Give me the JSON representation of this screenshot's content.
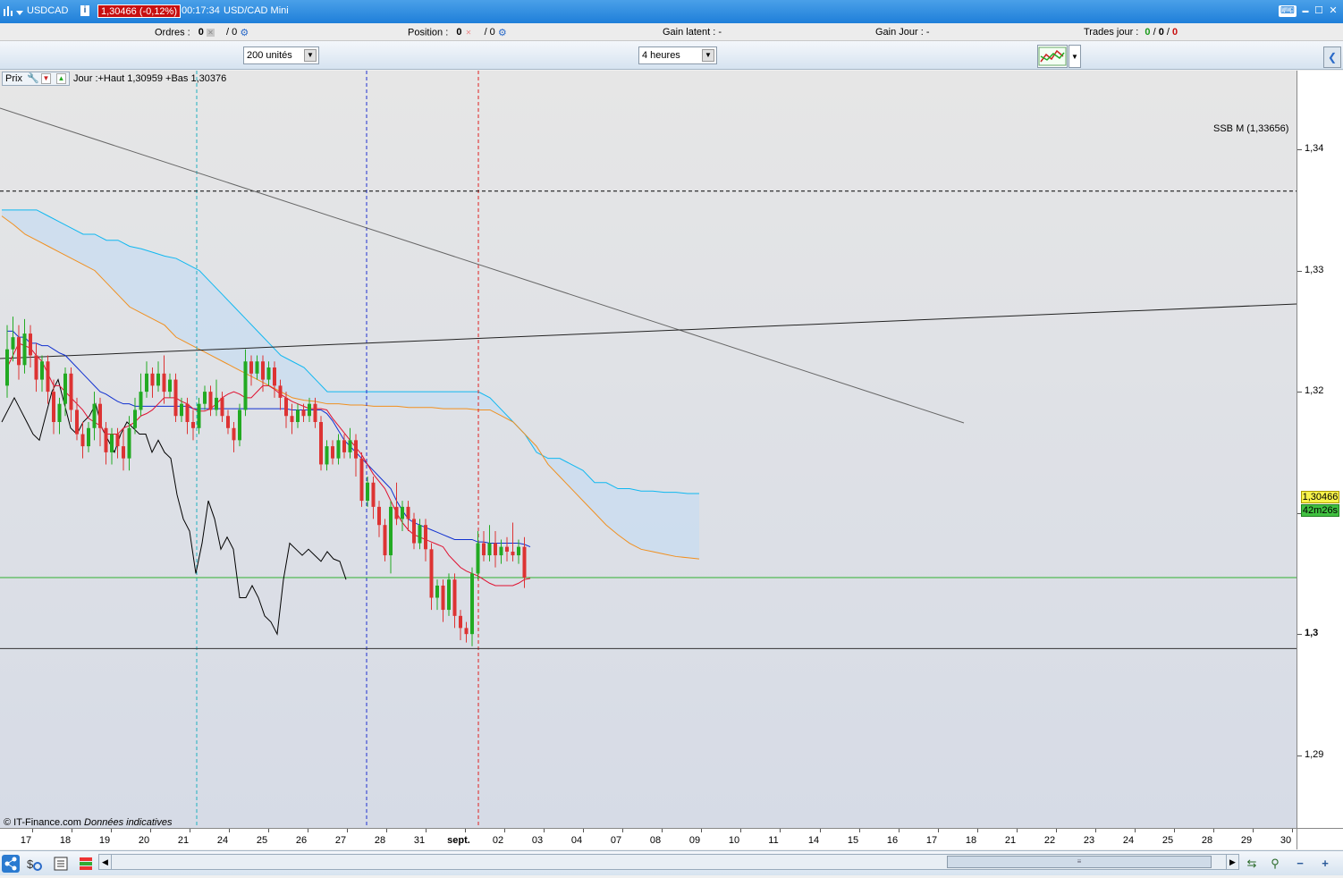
{
  "titlebar": {
    "symbol": "USDCAD",
    "info": "i",
    "price_badge": "1,30466 (-0,12%)",
    "time": "00:17:34",
    "name": "USD/CAD Mini",
    "kbd_icon": "⌨",
    "min": "▬",
    "max": "☐",
    "close": "✕"
  },
  "toolbar": {
    "ordres_label": "Ordres :",
    "ordres_value": "0",
    "ordres_slash": "/ 0",
    "position_label": "Position :",
    "position_value": "0",
    "position_slash": "/ 0",
    "gain_latent": "Gain latent :  -",
    "gain_jour": "Gain Jour :  -",
    "trades_label": "Trades jour :",
    "trades_a": "0",
    "trades_b": "0",
    "trades_c": "0",
    "quantity_select": "200 unités",
    "period_select": "4 heures",
    "x_glyph": "✕",
    "gear_glyph": "⚙"
  },
  "chart": {
    "prix_label": "Prix",
    "ohlc_text": "Jour :+Haut 1,30959 +Bas 1,30376",
    "ssb_label": "SSB M (1,33656)",
    "copyright": "© IT-Finance.com",
    "disclaimer": "Données indicatives",
    "price_tag": "1,30466",
    "timer_tag": "42m26s"
  },
  "colors": {
    "bull": "#22aa22",
    "bear": "#dd3333",
    "tenkan": "#e01030",
    "kijun": "#1030d0",
    "ssa": "#f09020",
    "ssb": "#10b8f0",
    "chikou": "#000000",
    "cloud": "#c8dcf0"
  },
  "chart_data": {
    "type": "candlestick",
    "ylim": [
      1.284,
      1.3465
    ],
    "y_ticks": [
      "1,34",
      "1,33",
      "1,32",
      "1,31",
      "1,3",
      "1,29"
    ],
    "x_ticks": [
      "17",
      "18",
      "19",
      "20",
      "21",
      "24",
      "25",
      "26",
      "27",
      "28",
      "31",
      "sept.",
      "02",
      "03",
      "04",
      "07",
      "08",
      "09",
      "10",
      "11",
      "14",
      "15",
      "16",
      "17",
      "18",
      "21",
      "22",
      "23",
      "24",
      "25",
      "28",
      "29",
      "30"
    ],
    "current_price": 1.30466,
    "ssb_level": 1.33656,
    "support_level": 1.2988,
    "candles": [
      {
        "o": 1.3205,
        "c": 1.3235,
        "h": 1.3255,
        "l": 1.3195
      },
      {
        "o": 1.3235,
        "c": 1.3245,
        "h": 1.3262,
        "l": 1.3225
      },
      {
        "o": 1.3245,
        "c": 1.3222,
        "h": 1.3255,
        "l": 1.321
      },
      {
        "o": 1.3222,
        "c": 1.3248,
        "h": 1.326,
        "l": 1.3215
      },
      {
        "o": 1.3248,
        "c": 1.323,
        "h": 1.3255,
        "l": 1.322
      },
      {
        "o": 1.323,
        "c": 1.321,
        "h": 1.324,
        "l": 1.32
      },
      {
        "o": 1.321,
        "c": 1.3225,
        "h": 1.323,
        "l": 1.32
      },
      {
        "o": 1.3225,
        "c": 1.32,
        "h": 1.323,
        "l": 1.319
      },
      {
        "o": 1.32,
        "c": 1.3175,
        "h": 1.321,
        "l": 1.3165
      },
      {
        "o": 1.3175,
        "c": 1.319,
        "h": 1.3195,
        "l": 1.3165
      },
      {
        "o": 1.319,
        "c": 1.3215,
        "h": 1.322,
        "l": 1.318
      },
      {
        "o": 1.3215,
        "c": 1.3185,
        "h": 1.322,
        "l": 1.3175
      },
      {
        "o": 1.3185,
        "c": 1.3165,
        "h": 1.3195,
        "l": 1.316
      },
      {
        "o": 1.3165,
        "c": 1.3155,
        "h": 1.3175,
        "l": 1.3145
      },
      {
        "o": 1.3155,
        "c": 1.317,
        "h": 1.3175,
        "l": 1.315
      },
      {
        "o": 1.317,
        "c": 1.319,
        "h": 1.32,
        "l": 1.316
      },
      {
        "o": 1.319,
        "c": 1.317,
        "h": 1.3195,
        "l": 1.3155
      },
      {
        "o": 1.317,
        "c": 1.315,
        "h": 1.3175,
        "l": 1.314
      },
      {
        "o": 1.315,
        "c": 1.3165,
        "h": 1.317,
        "l": 1.314
      },
      {
        "o": 1.3165,
        "c": 1.3155,
        "h": 1.317,
        "l": 1.3145
      },
      {
        "o": 1.3155,
        "c": 1.3145,
        "h": 1.317,
        "l": 1.3135
      },
      {
        "o": 1.3145,
        "c": 1.317,
        "h": 1.318,
        "l": 1.3135
      },
      {
        "o": 1.317,
        "c": 1.3185,
        "h": 1.3195,
        "l": 1.3165
      },
      {
        "o": 1.3185,
        "c": 1.32,
        "h": 1.3215,
        "l": 1.318
      },
      {
        "o": 1.32,
        "c": 1.3215,
        "h": 1.3225,
        "l": 1.3195
      },
      {
        "o": 1.3215,
        "c": 1.3205,
        "h": 1.322,
        "l": 1.3195
      },
      {
        "o": 1.3205,
        "c": 1.3215,
        "h": 1.3225,
        "l": 1.32
      },
      {
        "o": 1.3215,
        "c": 1.32,
        "h": 1.323,
        "l": 1.319
      },
      {
        "o": 1.32,
        "c": 1.321,
        "h": 1.3215,
        "l": 1.3195
      },
      {
        "o": 1.321,
        "c": 1.318,
        "h": 1.3215,
        "l": 1.3175
      },
      {
        "o": 1.318,
        "c": 1.319,
        "h": 1.3195,
        "l": 1.3175
      },
      {
        "o": 1.319,
        "c": 1.3175,
        "h": 1.3195,
        "l": 1.3165
      },
      {
        "o": 1.3175,
        "c": 1.317,
        "h": 1.3185,
        "l": 1.316
      },
      {
        "o": 1.317,
        "c": 1.319,
        "h": 1.3195,
        "l": 1.3165
      },
      {
        "o": 1.319,
        "c": 1.32,
        "h": 1.3205,
        "l": 1.3185
      },
      {
        "o": 1.32,
        "c": 1.3185,
        "h": 1.3205,
        "l": 1.318
      },
      {
        "o": 1.3185,
        "c": 1.3195,
        "h": 1.321,
        "l": 1.318
      },
      {
        "o": 1.3195,
        "c": 1.318,
        "h": 1.32,
        "l": 1.3175
      },
      {
        "o": 1.318,
        "c": 1.317,
        "h": 1.3185,
        "l": 1.3165
      },
      {
        "o": 1.317,
        "c": 1.316,
        "h": 1.3175,
        "l": 1.315
      },
      {
        "o": 1.316,
        "c": 1.3185,
        "h": 1.319,
        "l": 1.3155
      },
      {
        "o": 1.3185,
        "c": 1.3225,
        "h": 1.3235,
        "l": 1.318
      },
      {
        "o": 1.3225,
        "c": 1.3215,
        "h": 1.323,
        "l": 1.3205
      },
      {
        "o": 1.3215,
        "c": 1.3225,
        "h": 1.323,
        "l": 1.321
      },
      {
        "o": 1.3225,
        "c": 1.321,
        "h": 1.323,
        "l": 1.32
      },
      {
        "o": 1.321,
        "c": 1.322,
        "h": 1.3225,
        "l": 1.3205
      },
      {
        "o": 1.322,
        "c": 1.3205,
        "h": 1.3225,
        "l": 1.3195
      },
      {
        "o": 1.3205,
        "c": 1.3195,
        "h": 1.321,
        "l": 1.3185
      },
      {
        "o": 1.3195,
        "c": 1.318,
        "h": 1.32,
        "l": 1.317
      },
      {
        "o": 1.318,
        "c": 1.3175,
        "h": 1.319,
        "l": 1.3165
      },
      {
        "o": 1.3175,
        "c": 1.3185,
        "h": 1.319,
        "l": 1.317
      },
      {
        "o": 1.3185,
        "c": 1.318,
        "h": 1.319,
        "l": 1.3175
      },
      {
        "o": 1.318,
        "c": 1.319,
        "h": 1.3195,
        "l": 1.3175
      },
      {
        "o": 1.319,
        "c": 1.3175,
        "h": 1.3195,
        "l": 1.317
      },
      {
        "o": 1.3175,
        "c": 1.314,
        "h": 1.318,
        "l": 1.3135
      },
      {
        "o": 1.314,
        "c": 1.3155,
        "h": 1.316,
        "l": 1.3135
      },
      {
        "o": 1.3155,
        "c": 1.3145,
        "h": 1.316,
        "l": 1.314
      },
      {
        "o": 1.3145,
        "c": 1.316,
        "h": 1.3165,
        "l": 1.314
      },
      {
        "o": 1.316,
        "c": 1.315,
        "h": 1.3165,
        "l": 1.3145
      },
      {
        "o": 1.315,
        "c": 1.316,
        "h": 1.317,
        "l": 1.3145
      },
      {
        "o": 1.316,
        "c": 1.3145,
        "h": 1.3165,
        "l": 1.313
      },
      {
        "o": 1.3145,
        "c": 1.311,
        "h": 1.315,
        "l": 1.3105
      },
      {
        "o": 1.311,
        "c": 1.3125,
        "h": 1.313,
        "l": 1.3105
      },
      {
        "o": 1.3125,
        "c": 1.3105,
        "h": 1.313,
        "l": 1.3095
      },
      {
        "o": 1.3105,
        "c": 1.309,
        "h": 1.311,
        "l": 1.308
      },
      {
        "o": 1.309,
        "c": 1.3065,
        "h": 1.3095,
        "l": 1.306
      },
      {
        "o": 1.3065,
        "c": 1.3105,
        "h": 1.311,
        "l": 1.305
      },
      {
        "o": 1.3105,
        "c": 1.3095,
        "h": 1.3125,
        "l": 1.309
      },
      {
        "o": 1.3095,
        "c": 1.3105,
        "h": 1.311,
        "l": 1.3085
      },
      {
        "o": 1.3105,
        "c": 1.3095,
        "h": 1.311,
        "l": 1.3085
      },
      {
        "o": 1.3095,
        "c": 1.3075,
        "h": 1.31,
        "l": 1.307
      },
      {
        "o": 1.3075,
        "c": 1.309,
        "h": 1.3095,
        "l": 1.307
      },
      {
        "o": 1.309,
        "c": 1.307,
        "h": 1.3095,
        "l": 1.306
      },
      {
        "o": 1.307,
        "c": 1.303,
        "h": 1.3075,
        "l": 1.302
      },
      {
        "o": 1.303,
        "c": 1.304,
        "h": 1.3045,
        "l": 1.302
      },
      {
        "o": 1.304,
        "c": 1.302,
        "h": 1.3045,
        "l": 1.301
      },
      {
        "o": 1.302,
        "c": 1.3045,
        "h": 1.305,
        "l": 1.3015
      },
      {
        "o": 1.3045,
        "c": 1.3015,
        "h": 1.305,
        "l": 1.3005
      },
      {
        "o": 1.3015,
        "c": 1.3005,
        "h": 1.302,
        "l": 1.2995
      },
      {
        "o": 1.3005,
        "c": 1.3,
        "h": 1.301,
        "l": 1.2993
      },
      {
        "o": 1.3,
        "c": 1.305,
        "h": 1.3055,
        "l": 1.299
      },
      {
        "o": 1.305,
        "c": 1.3075,
        "h": 1.3085,
        "l": 1.3045
      },
      {
        "o": 1.3075,
        "c": 1.3065,
        "h": 1.3085,
        "l": 1.306
      },
      {
        "o": 1.3065,
        "c": 1.3075,
        "h": 1.309,
        "l": 1.306
      },
      {
        "o": 1.3075,
        "c": 1.3065,
        "h": 1.3085,
        "l": 1.3055
      },
      {
        "o": 1.3065,
        "c": 1.3072,
        "h": 1.3078,
        "l": 1.3058
      },
      {
        "o": 1.3072,
        "c": 1.3068,
        "h": 1.308,
        "l": 1.306
      },
      {
        "o": 1.3068,
        "c": 1.3065,
        "h": 1.3092,
        "l": 1.306
      },
      {
        "o": 1.3065,
        "c": 1.3072,
        "h": 1.3078,
        "l": 1.3058
      },
      {
        "o": 1.3072,
        "c": 1.30466,
        "h": 1.308,
        "l": 1.3038
      }
    ],
    "tenkan": [
      1.322,
      1.323,
      1.324,
      1.3238,
      1.3236,
      1.323,
      1.3225,
      1.3215,
      1.3205,
      1.3205,
      1.32,
      1.3195,
      1.319,
      1.3185,
      1.3178,
      1.3175,
      1.3172,
      1.3165,
      1.3165,
      1.3165,
      1.317,
      1.3172,
      1.3175,
      1.318,
      1.3182,
      1.3185,
      1.319,
      1.3195,
      1.3195,
      1.3195,
      1.3192,
      1.319,
      1.3186,
      1.3184,
      1.3184,
      1.3186,
      1.319,
      1.3195,
      1.3198,
      1.32,
      1.3198,
      1.3195,
      1.3195,
      1.32,
      1.3205,
      1.3205,
      1.3202,
      1.3198,
      1.3195,
      1.3192,
      1.319,
      1.3188,
      1.3186,
      1.3186,
      1.3186,
      1.3185,
      1.3178,
      1.3172,
      1.3166,
      1.316,
      1.3154,
      1.3148,
      1.314,
      1.3132,
      1.3126,
      1.312,
      1.311,
      1.31,
      1.3092,
      1.3086,
      1.3082,
      1.308,
      1.3078,
      1.3076,
      1.3074,
      1.3072,
      1.3065,
      1.306,
      1.3055,
      1.3052,
      1.305,
      1.3048,
      1.3045,
      1.3042,
      1.304,
      1.304,
      1.304,
      1.304,
      1.3042,
      1.3045,
      1.3046
    ],
    "kijun": [
      1.325,
      1.325,
      1.3245,
      1.3245,
      1.324,
      1.324,
      1.3238,
      1.3238,
      1.3235,
      1.3232,
      1.323,
      1.3225,
      1.322,
      1.3215,
      1.321,
      1.3205,
      1.32,
      1.3198,
      1.3195,
      1.3192,
      1.319,
      1.319,
      1.3188,
      1.3188,
      1.3188,
      1.3188,
      1.3188,
      1.3188,
      1.3188,
      1.3188,
      1.3188,
      1.3188,
      1.3186,
      1.3186,
      1.3186,
      1.3186,
      1.3186,
      1.3186,
      1.3186,
      1.3186,
      1.3186,
      1.3186,
      1.3186,
      1.3186,
      1.3186,
      1.3186,
      1.3186,
      1.3186,
      1.3186,
      1.3185,
      1.3185,
      1.3185,
      1.3185,
      1.3185,
      1.3185,
      1.3182,
      1.3176,
      1.3168,
      1.316,
      1.3155,
      1.315,
      1.3145,
      1.314,
      1.3135,
      1.313,
      1.3125,
      1.312,
      1.311,
      1.3102,
      1.3095,
      1.3092,
      1.309,
      1.3088,
      1.3086,
      1.3084,
      1.3082,
      1.308,
      1.3078,
      1.3078,
      1.3078,
      1.3078,
      1.3076,
      1.3076,
      1.3075,
      1.3075,
      1.3075,
      1.3075,
      1.3075,
      1.3075,
      1.3074,
      1.3072
    ],
    "ssa": [
      1.3345,
      1.3338,
      1.333,
      1.3325,
      1.332,
      1.3315,
      1.331,
      1.3305,
      1.33,
      1.329,
      1.328,
      1.327,
      1.3265,
      1.326,
      1.3255,
      1.3245,
      1.324,
      1.3235,
      1.323,
      1.3225,
      1.322,
      1.3215,
      1.321,
      1.3205,
      1.32,
      1.3195,
      1.3193,
      1.3192,
      1.319,
      1.319,
      1.3189,
      1.3189,
      1.3188,
      1.3188,
      1.3188,
      1.3187,
      1.3187,
      1.3187,
      1.3186,
      1.3186,
      1.3186,
      1.3185,
      1.3185,
      1.318,
      1.3175,
      1.3165,
      1.3155,
      1.314,
      1.313,
      1.312,
      1.311,
      1.31,
      1.309,
      1.3082,
      1.3075,
      1.307,
      1.3068,
      1.3066,
      1.3064,
      1.3063,
      1.3062
    ],
    "ssb": [
      1.335,
      1.335,
      1.335,
      1.335,
      1.3345,
      1.334,
      1.3335,
      1.333,
      1.333,
      1.3325,
      1.3325,
      1.332,
      1.3318,
      1.3315,
      1.3312,
      1.331,
      1.3305,
      1.33,
      1.329,
      1.328,
      1.327,
      1.326,
      1.325,
      1.324,
      1.323,
      1.3225,
      1.322,
      1.321,
      1.32,
      1.32,
      1.32,
      1.32,
      1.32,
      1.32,
      1.32,
      1.32,
      1.32,
      1.32,
      1.32,
      1.32,
      1.32,
      1.32,
      1.3195,
      1.3185,
      1.3175,
      1.3165,
      1.315,
      1.3145,
      1.3145,
      1.314,
      1.3135,
      1.3125,
      1.3125,
      1.312,
      1.312,
      1.3118,
      1.3118,
      1.3117,
      1.3117,
      1.3116,
      1.3116
    ],
    "chikou": [
      1.3175,
      1.3185,
      1.3195,
      1.3185,
      1.3175,
      1.3165,
      1.316,
      1.318,
      1.32,
      1.321,
      1.319,
      1.317,
      1.3165,
      1.3175,
      1.318,
      1.319,
      1.317,
      1.316,
      1.315,
      1.3165,
      1.3175,
      1.317,
      1.3165,
      1.3165,
      1.315,
      1.316,
      1.315,
      1.3145,
      1.3115,
      1.3095,
      1.3085,
      1.305,
      1.3075,
      1.311,
      1.3095,
      1.307,
      1.308,
      1.307,
      1.303,
      1.303,
      1.304,
      1.303,
      1.3015,
      1.301,
      1.3,
      1.3045,
      1.3075,
      1.307,
      1.3065,
      1.307,
      1.3065,
      1.306,
      1.3068,
      1.3062,
      1.306,
      1.3045
    ]
  },
  "bottombar": {
    "share_icon": "⟲",
    "scroll_left": "◀",
    "scroll_right": "▶",
    "thumb_grip": "≡",
    "zoom_icons": [
      "⇆",
      "⚲",
      "−",
      "+"
    ]
  }
}
